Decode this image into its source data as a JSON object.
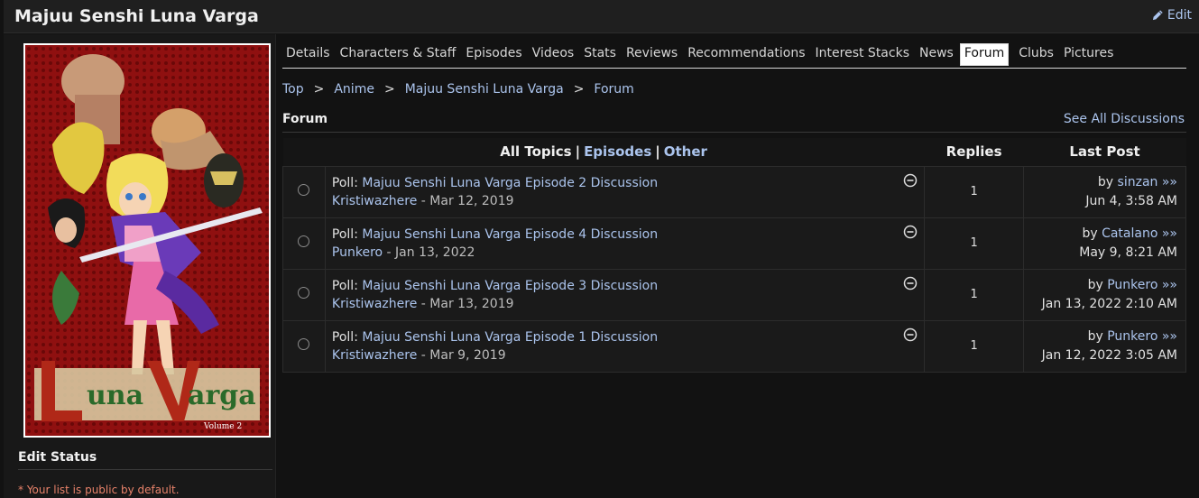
{
  "header": {
    "title": "Majuu Senshi Luna Varga",
    "edit_label": "Edit"
  },
  "sidebar": {
    "edit_status_label": "Edit Status",
    "public_note": "* Your list is public by default."
  },
  "tabs": [
    {
      "label": "Details"
    },
    {
      "label": "Characters & Staff"
    },
    {
      "label": "Episodes"
    },
    {
      "label": "Videos"
    },
    {
      "label": "Stats"
    },
    {
      "label": "Reviews"
    },
    {
      "label": "Recommendations"
    },
    {
      "label": "Interest Stacks"
    },
    {
      "label": "News"
    },
    {
      "label": "Forum",
      "active": true
    },
    {
      "label": "Clubs"
    },
    {
      "label": "Pictures"
    }
  ],
  "breadcrumb": [
    "Top",
    "Anime",
    "Majuu Senshi Luna Varga",
    "Forum"
  ],
  "forum": {
    "title": "Forum",
    "see_all": "See All Discussions",
    "filters": {
      "all": "All Topics",
      "episodes": "Episodes",
      "other": "Other",
      "separator": "|"
    },
    "columns": {
      "replies": "Replies",
      "last_post": "Last Post"
    },
    "topics": [
      {
        "prefix": "Poll:",
        "title": "Majuu Senshi Luna Varga Episode 2 Discussion",
        "author": "Kristiwazhere",
        "date": "- Mar 12, 2019",
        "replies": "1",
        "last_by_prefix": "by",
        "last_by": "sinzan",
        "arrow": "»»",
        "last_time": "Jun 4, 3:58 AM"
      },
      {
        "prefix": "Poll:",
        "title": "Majuu Senshi Luna Varga Episode 4 Discussion",
        "author": "Punkero",
        "date": "- Jan 13, 2022",
        "replies": "1",
        "last_by_prefix": "by",
        "last_by": "Catalano",
        "arrow": "»»",
        "last_time": "May 9, 8:21 AM"
      },
      {
        "prefix": "Poll:",
        "title": "Majuu Senshi Luna Varga Episode 3 Discussion",
        "author": "Kristiwazhere",
        "date": "- Mar 13, 2019",
        "replies": "1",
        "last_by_prefix": "by",
        "last_by": "Punkero",
        "arrow": "»»",
        "last_time": "Jan 13, 2022 2:10 AM"
      },
      {
        "prefix": "Poll:",
        "title": "Majuu Senshi Luna Varga Episode 1 Discussion",
        "author": "Kristiwazhere",
        "date": "- Mar 9, 2019",
        "replies": "1",
        "last_by_prefix": "by",
        "last_by": "Punkero",
        "arrow": "»»",
        "last_time": "Jan 12, 2022 3:05 AM"
      }
    ]
  },
  "colors": {
    "link": "#abc4ed",
    "background": "#121212",
    "note": "#e8826a"
  },
  "icons": {
    "edit": "pencil-icon",
    "topic_state": "minus-circle-icon"
  }
}
